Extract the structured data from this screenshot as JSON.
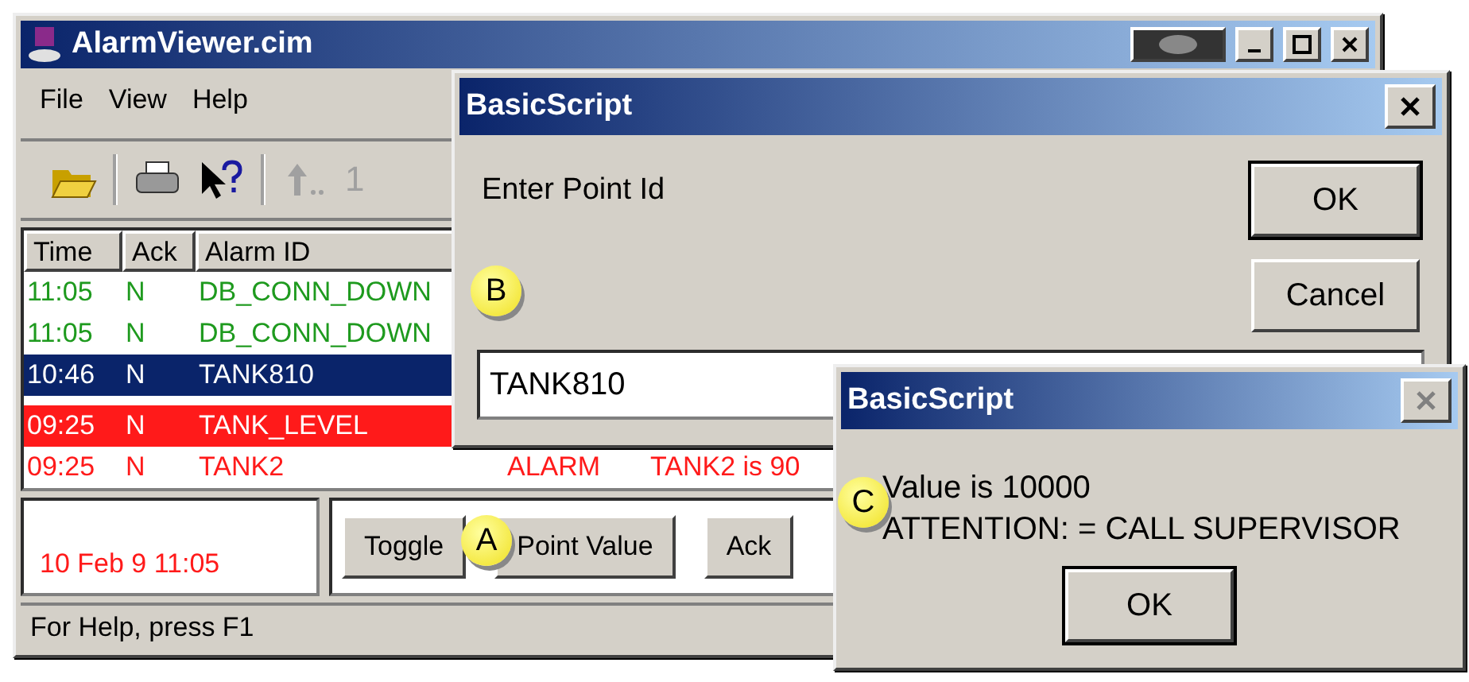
{
  "main_window": {
    "title": "AlarmViewer.cim",
    "menu": [
      "File",
      "View",
      "Help"
    ],
    "toolbar": {
      "page_number": "1",
      "disabled": true
    },
    "table": {
      "columns": [
        "Time",
        "Ack",
        "Alarm ID"
      ],
      "rows": [
        {
          "time": "11:05",
          "ack": "N",
          "alarm_id": "DB_CONN_DOWN",
          "color": "#1e9a1e",
          "kind": "normal",
          "selected": false
        },
        {
          "time": "11:05",
          "ack": "N",
          "alarm_id": "DB_CONN_DOWN",
          "color": "#1e9a1e",
          "kind": "normal",
          "selected": false
        },
        {
          "time": "10:46",
          "ack": "N",
          "alarm_id": "TANK810",
          "color": "#ffffff",
          "kind": "normal",
          "selected": true
        },
        {
          "time": "09:25",
          "ack": "N",
          "alarm_id": "TANK_LEVEL",
          "color": "#ff1a1a",
          "kind": "highlighted",
          "selected": false
        },
        {
          "time": "09:25",
          "ack": "N",
          "alarm_id": "TANK2",
          "column_4": "ALARM",
          "column_5": "TANK2 is 90",
          "color": "#ff1a1a",
          "kind": "normal",
          "selected": false
        }
      ]
    },
    "timestamp": "10 Feb 9 11:05",
    "buttons": [
      "Toggle",
      "Point Value",
      "Ack"
    ],
    "status_bar": "For Help, press F1"
  },
  "input_dialog": {
    "title": "BasicScript",
    "prompt": "Enter Point Id",
    "value": "TANK810",
    "buttons": [
      "OK",
      "Cancel"
    ]
  },
  "message_dialog": {
    "title": "BasicScript",
    "lines": [
      "Value is 10000",
      "ATTENTION: = CALL SUPERVISOR"
    ],
    "button": "OK"
  },
  "callouts": [
    {
      "label": "A"
    },
    {
      "label": "B"
    },
    {
      "label": "C"
    }
  ]
}
